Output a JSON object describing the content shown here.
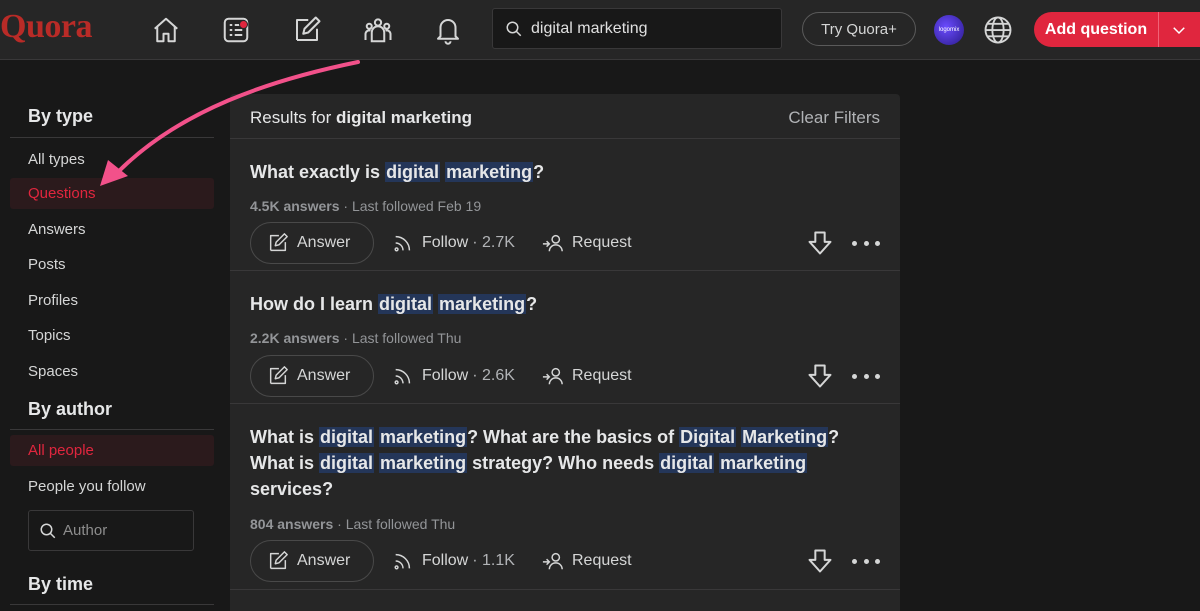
{
  "header": {
    "logo": "Quora",
    "search_value": "digital marketing",
    "try_label": "Try Quora+",
    "avatar_text": "logomix",
    "add_question_label": "Add question"
  },
  "sidebar": {
    "by_type": "By type",
    "type_items": [
      "All types",
      "Questions",
      "Answers",
      "Posts",
      "Profiles",
      "Topics",
      "Spaces"
    ],
    "active_type": "Questions",
    "by_author": "By author",
    "author_items": [
      "All people",
      "People you follow"
    ],
    "active_author": "All people",
    "author_placeholder": "Author",
    "by_time": "By time"
  },
  "results": {
    "prefix": "Results for",
    "query": "digital marketing",
    "clear_filters": "Clear Filters",
    "answer_label": "Answer",
    "follow_label": "Follow",
    "request_label": "Request",
    "questions": [
      {
        "parts": [
          [
            "What exactly is ",
            false
          ],
          [
            "digital",
            true
          ],
          [
            " ",
            false
          ],
          [
            "marketing",
            true
          ],
          [
            "?",
            false
          ]
        ],
        "answers": "4.5K answers",
        "followed": " · Last followed Feb 19",
        "follow_count": "2.7K"
      },
      {
        "parts": [
          [
            "How do I learn ",
            false
          ],
          [
            "digital",
            true
          ],
          [
            " ",
            false
          ],
          [
            "marketing",
            true
          ],
          [
            "?",
            false
          ]
        ],
        "answers": "2.2K answers",
        "followed": " · Last followed Thu",
        "follow_count": "2.6K"
      },
      {
        "parts": [
          [
            "What is ",
            false
          ],
          [
            "digital",
            true
          ],
          [
            " ",
            false
          ],
          [
            "marketing",
            true
          ],
          [
            "? What are the basics of ",
            false
          ],
          [
            "Digital",
            true
          ],
          [
            " ",
            false
          ],
          [
            "Marketing",
            true
          ],
          [
            "? What is ",
            false
          ],
          [
            "digital",
            true
          ],
          [
            " ",
            false
          ],
          [
            "marketing",
            true
          ],
          [
            " strategy? Who needs ",
            false
          ],
          [
            "digital",
            true
          ],
          [
            " ",
            false
          ],
          [
            "marketing",
            true
          ],
          [
            " services?",
            false
          ]
        ],
        "answers": "804 answers",
        "followed": " · Last followed Thu",
        "follow_count": "1.1K"
      }
    ]
  },
  "colors": {
    "accent": "#e0263e",
    "logo": "#b92b27",
    "highlight": "#243659",
    "arrow": "#f2518a"
  }
}
